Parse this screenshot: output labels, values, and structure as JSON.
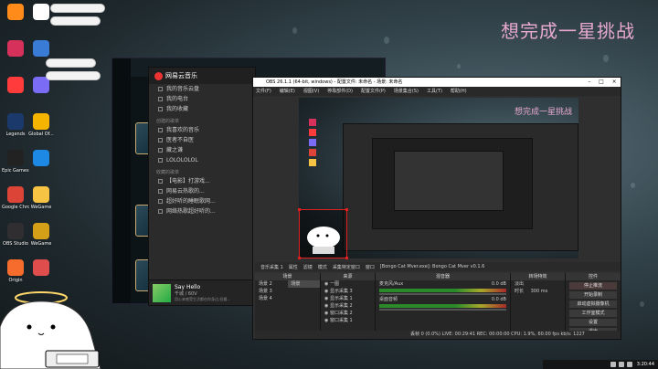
{
  "overlay": {
    "title": "想完成一星挑战"
  },
  "desktop_icons": [
    {
      "label": "",
      "color": "#ff8c1a"
    },
    {
      "label": "",
      "color": "#ffffff"
    },
    {
      "label": "",
      "color": "#d6315b"
    },
    {
      "label": "",
      "color": "#3a7bd5"
    },
    {
      "label": "",
      "color": "#ff3b3b"
    },
    {
      "label": "",
      "color": "#7b6cf6"
    },
    {
      "label": "Legends",
      "color": "#1b3a6b"
    },
    {
      "label": "Global Of...",
      "color": "#f4b400"
    },
    {
      "label": "Epic Games Launcher",
      "color": "#222222"
    },
    {
      "label": "",
      "color": "#1e88e5"
    },
    {
      "label": "Google Chrome",
      "color": "#db4437"
    },
    {
      "label": "WeGame",
      "color": "#f6c343"
    },
    {
      "label": "OBS Studio",
      "color": "#302e31"
    },
    {
      "label": "WeGame",
      "color": "#d4a017"
    },
    {
      "label": "Origin",
      "color": "#f56c2d"
    },
    {
      "label": "",
      "color": "#e04d4d"
    }
  ],
  "netease": {
    "title": "网易云音乐",
    "section_mine": "",
    "items_top": [
      "我的音乐云盘",
      "我的电台",
      "我的收藏"
    ],
    "section_created": "创建的歌单",
    "items_created": [
      "我喜欢的音乐",
      "医者不自医",
      "藏之谦",
      "LOLOLOLOL"
    ],
    "section_fav": "收藏的歌单",
    "items_fav": [
      "【电影】打游戏...",
      "网易云热歌的...",
      "超好听的睡眠歌网...",
      "网络热歌超好听的..."
    ],
    "now_playing": {
      "title": "Say Hello",
      "artist": "千城 / 60V",
      "subtitle": "用心来感受生活都在你身边,但遇..."
    }
  },
  "obs": {
    "window_title": "OBS 26.1.1 (64-bit, windows) - 配置文件: 未命名 - 场景: 未命名",
    "menu": [
      "文件(F)",
      "编辑(E)",
      "视图(V)",
      "停靠部件(D)",
      "配置文件(P)",
      "场景集合(S)",
      "工具(T)",
      "帮助(H)"
    ],
    "source_bar": [
      "音乐采集 1",
      "属性",
      "滤镜",
      "模式",
      "采集特定窗口",
      "窗口",
      "[Bongo Cat Mver.exe]: Bongo Cat Mver v0.1.6"
    ],
    "docks": {
      "scenes_title": "场景",
      "scenes": [
        "场景 2",
        "场景 3",
        "场景 4"
      ],
      "scenes_selected": "场景",
      "sources_title": "来源",
      "sources": [
        "一图",
        "显示采集 3",
        "显示采集 1",
        "显示采集 2",
        "窗口采集 2",
        "窗口采集 1"
      ],
      "mixer_title": "混音器",
      "mixer_tracks": [
        {
          "name": "麦克风/Aux",
          "db": "0.0 dB"
        },
        {
          "name": "桌面音频",
          "db": "0.0 dB"
        }
      ],
      "transitions_title": "转场特效",
      "transition_type": "淡出",
      "duration_label": "时长",
      "duration": "300 ms",
      "controls_title": "控件",
      "controls": [
        "停止推流",
        "开始录制",
        "启动虚拟摄像机",
        "工作室模式",
        "设置",
        "退出"
      ]
    },
    "status": "丢帧 0 (0.0%)  LIVE: 00:29:41  REC: 00:00:00  CPU: 1.9%, 60.00 fps  kb/s: 1227"
  },
  "taskbar": {
    "time": "3:20:44",
    "items": [
      "中",
      "英"
    ]
  }
}
